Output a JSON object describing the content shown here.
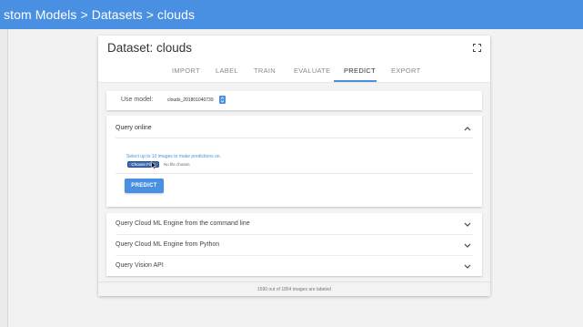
{
  "breadcrumb": "stom Models > Datasets > clouds",
  "dataset_title": "Dataset: clouds",
  "tabs": [
    {
      "label": "IMPORT",
      "active": false
    },
    {
      "label": "LABEL",
      "active": false
    },
    {
      "label": "TRAIN",
      "active": false
    },
    {
      "label": "EVALUATE",
      "active": false
    },
    {
      "label": "PREDICT",
      "active": true
    },
    {
      "label": "EXPORT",
      "active": false
    }
  ],
  "use_model": {
    "label": "Use model:",
    "value": "clouds_201801040739"
  },
  "query_online": {
    "header": "Query online",
    "instruction": "Select up to 10 images to make predictions on.",
    "choose_files_label": "Choose Files",
    "no_file_text": "No file chosen",
    "predict_label": "PREDICT"
  },
  "accordion": [
    {
      "label": "Query Cloud ML Engine from the command line"
    },
    {
      "label": "Query Cloud ML Engine from Python"
    },
    {
      "label": "Query Vision API"
    }
  ],
  "footer": "1590 out of 1854 images are labeled",
  "colors": {
    "accent": "#4a90e2",
    "topbar": "#4a90e2"
  },
  "icons": {
    "fullscreen": "fullscreen-icon",
    "expand_less": "chevron-up-icon",
    "expand_more": "chevron-down-icon",
    "dropdown": "dropdown-icon",
    "cursor": "mouse-pointer-icon"
  }
}
